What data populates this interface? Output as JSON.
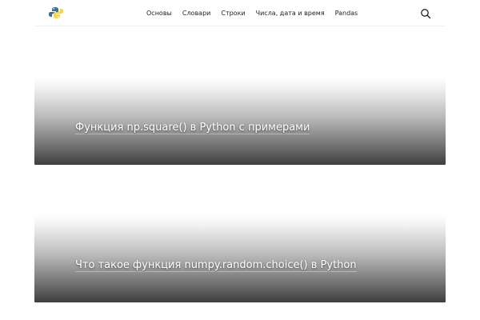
{
  "header": {
    "logo_icon": "python-logo-icon",
    "nav": [
      {
        "label": "Основы"
      },
      {
        "label": "Словари"
      },
      {
        "label": "Строки"
      },
      {
        "label": "Числа, дата и время"
      },
      {
        "label": "Pandas"
      }
    ],
    "search_icon": "search-icon"
  },
  "articles": [
    {
      "title": "Функция np.square() в Python с примерами"
    },
    {
      "title": "Что такое функция numpy.random.choice() в Python"
    }
  ],
  "colors": {
    "nav_text": "#222222",
    "card_dark": "#3e3e3e",
    "title_text": "#ffffff",
    "logo_blue": "#3572a5",
    "logo_yellow": "#ffd43b"
  }
}
